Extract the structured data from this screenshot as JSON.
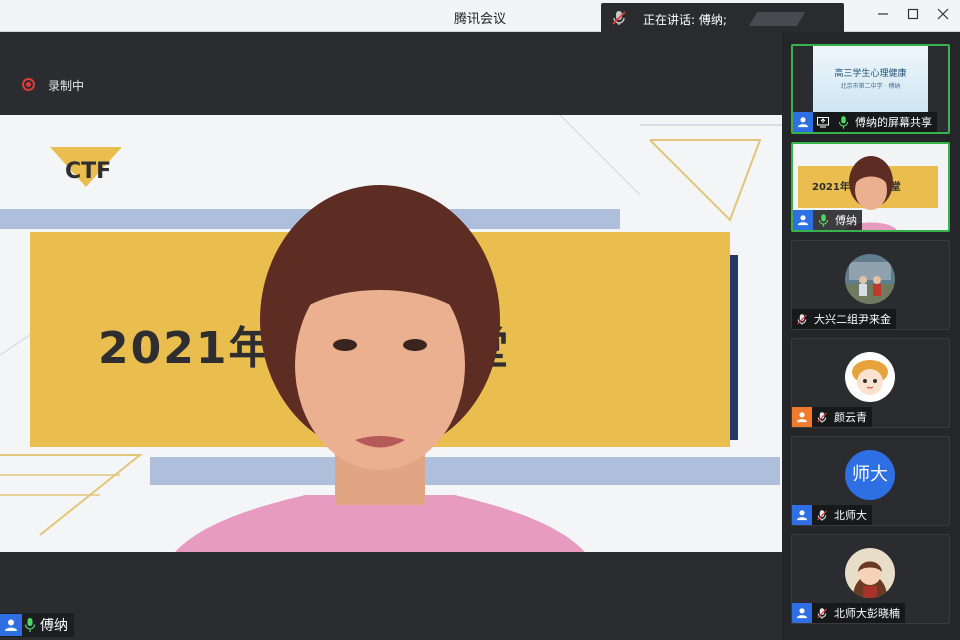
{
  "window": {
    "title": "腾讯会议"
  },
  "speaking": {
    "text": "正在讲话: 傅纳;"
  },
  "recording": {
    "label": "录制中"
  },
  "main_speaker": {
    "name": "傅纳"
  },
  "slide": {
    "logo_text": "CTF",
    "title": "2021年C      心理课堂"
  },
  "participants": [
    {
      "label": "傅纳的屏幕共享",
      "kind": "screen-share",
      "preview_title": "高三学生心理健康",
      "preview_subtitle": "北京市第二中学 · 傅纳"
    },
    {
      "label": "傅纳",
      "kind": "video",
      "preview_title": "2021年C      心理课堂"
    },
    {
      "label": "大兴二组尹来金",
      "kind": "avatar-photo"
    },
    {
      "label": "颜云青",
      "kind": "avatar-cartoon"
    },
    {
      "label": "北师大",
      "kind": "avatar-text",
      "avatar_text": "师大"
    },
    {
      "label": "北师大彭晓楠",
      "kind": "avatar-illustration"
    }
  ],
  "colors": {
    "accent_blue": "#2f6fe4",
    "active_green": "#37b24d",
    "slide_yellow": "#e9be4e",
    "recording_red": "#e03b3b"
  }
}
